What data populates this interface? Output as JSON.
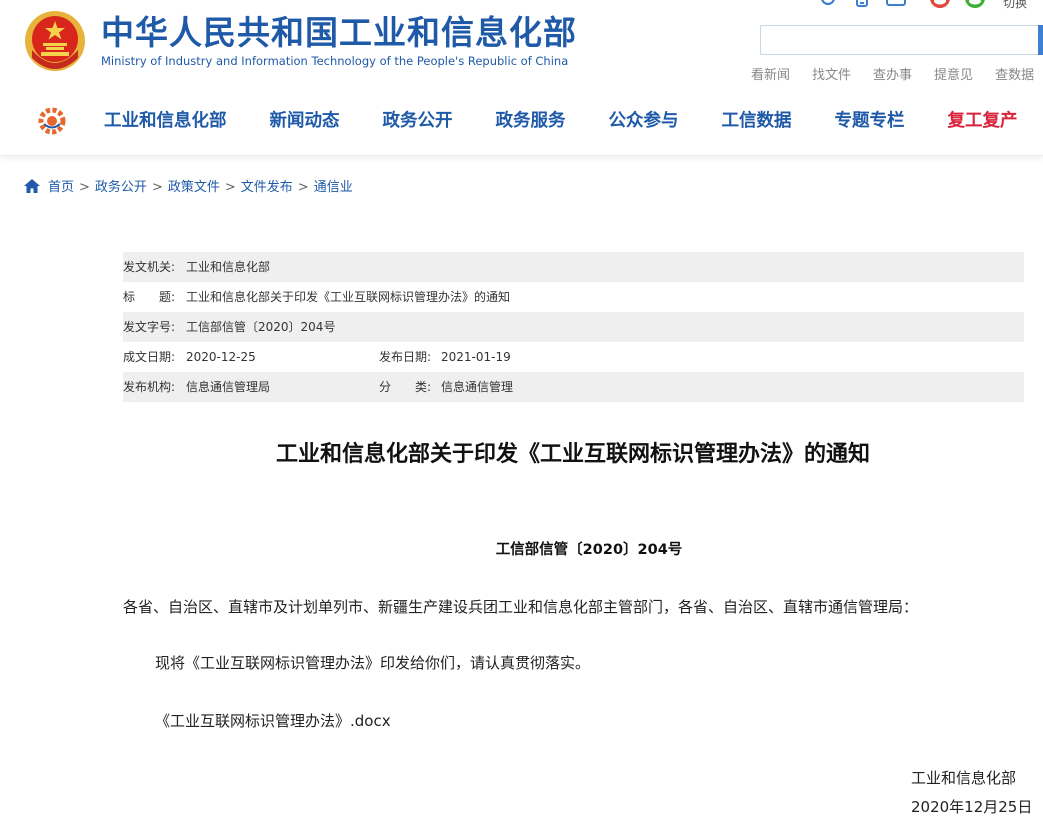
{
  "header": {
    "site_title_cn": "中华人民共和国工业和信息化部",
    "site_title_en": "Ministry of Industry and Information Technology of the People's Republic of China",
    "top_text": "切换",
    "search": {
      "placeholder": ""
    },
    "quick_links": [
      "看新闻",
      "找文件",
      "查办事",
      "提意见",
      "查数据"
    ]
  },
  "nav": {
    "items": [
      "工业和信息化部",
      "新闻动态",
      "政务公开",
      "政务服务",
      "公众参与",
      "工信数据",
      "专题专栏",
      "复工复产"
    ]
  },
  "breadcrumb": [
    "首页",
    "政务公开",
    "政策文件",
    "文件发布",
    "通信业"
  ],
  "meta": {
    "issuer_label": "发文机关:",
    "issuer": "工业和信息化部",
    "title_label": "标　　题:",
    "title": "工业和信息化部关于印发《工业互联网标识管理办法》的通知",
    "docno_label": "发文字号:",
    "docno": "工信部信管〔2020〕204号",
    "created_label": "成文日期:",
    "created": "2020-12-25",
    "published_label": "发布日期:",
    "published": "2021-01-19",
    "agency_label": "发布机构:",
    "agency": "信息通信管理局",
    "category_label": "分　　类:",
    "category": "信息通信管理"
  },
  "document": {
    "title": "工业和信息化部关于印发《工业互联网标识管理办法》的通知",
    "number": "工信部信管〔2020〕204号",
    "salutation": "各省、自治区、直辖市及计划单列市、新疆生产建设兵团工业和信息化部主管部门，各省、自治区、直辖市通信管理局：",
    "body": "现将《工业互联网标识管理办法》印发给你们，请认真贯彻落实。",
    "attachment": "《工业互联网标识管理办法》.docx",
    "signature": "工业和信息化部",
    "date": "2020年12月25日"
  },
  "colors": {
    "brand_blue": "#1f5aa8",
    "highlight_red": "#d9233c",
    "meta_shade": "#efefef"
  }
}
